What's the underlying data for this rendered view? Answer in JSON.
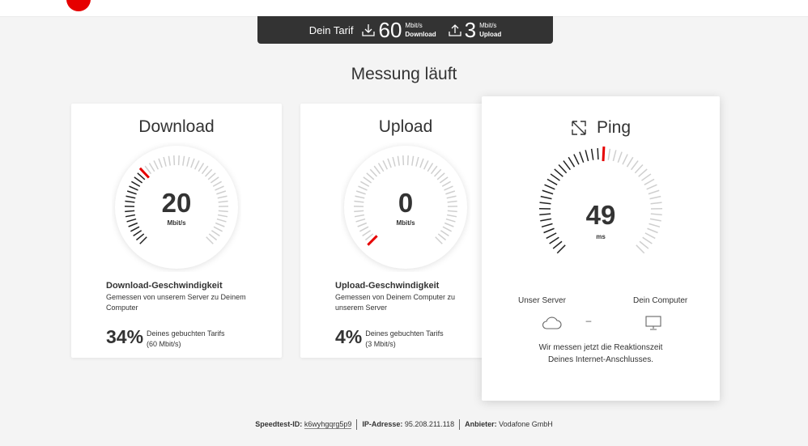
{
  "tariff": {
    "label": "Dein Tarif",
    "download_value": "60",
    "download_unit": "Mbit/s",
    "download_label": "Download",
    "upload_value": "3",
    "upload_unit": "Mbit/s",
    "upload_label": "Upload"
  },
  "status": {
    "heading": "Messung läuft"
  },
  "download": {
    "title": "Download",
    "value": "20",
    "unit": "Mbit/s",
    "needle_fraction": 0.333,
    "desc_title": "Download-Geschwindigkeit",
    "desc_text": "Gemessen von unserem Server zu Deinem Computer",
    "percent": "34%",
    "percent_line1": "Deines gebuchten Tarifs",
    "percent_line2": "(60 Mbit/s)"
  },
  "upload": {
    "title": "Upload",
    "value": "0",
    "unit": "Mbit/s",
    "needle_fraction": 0.0,
    "desc_title": "Upload-Geschwindigkeit",
    "desc_text": "Gemessen von Deinem Computer zu unserem Server",
    "percent": "4%",
    "percent_line1": "Deines gebuchten Tarifs",
    "percent_line2": "(3 Mbit/s)"
  },
  "ping": {
    "title": "Ping",
    "value": "49",
    "unit": "ms",
    "needle_fraction": 0.5,
    "server_label": "Unser Server",
    "computer_label": "Dein Computer",
    "dash": "–",
    "message_line1": "Wir messen jetzt die Reaktionszeit",
    "message_line2": "Deines Internet-Anschlusses."
  },
  "footer": {
    "id_label": "Speedtest-ID:",
    "id_value": "k6wyhgqrg5p9",
    "ip_label": "IP-Adresse:",
    "ip_value": "95.208.211.118",
    "provider_label": "Anbieter:",
    "provider_value": "Vodafone GmbH"
  },
  "colors": {
    "accent": "#e60000",
    "dark_bar": "#333333",
    "text": "#333333",
    "background": "#f4f4f4"
  },
  "icons": [
    "download-arrow-icon",
    "upload-arrow-icon",
    "ping-expand-icon",
    "cloud-icon",
    "monitor-icon"
  ]
}
